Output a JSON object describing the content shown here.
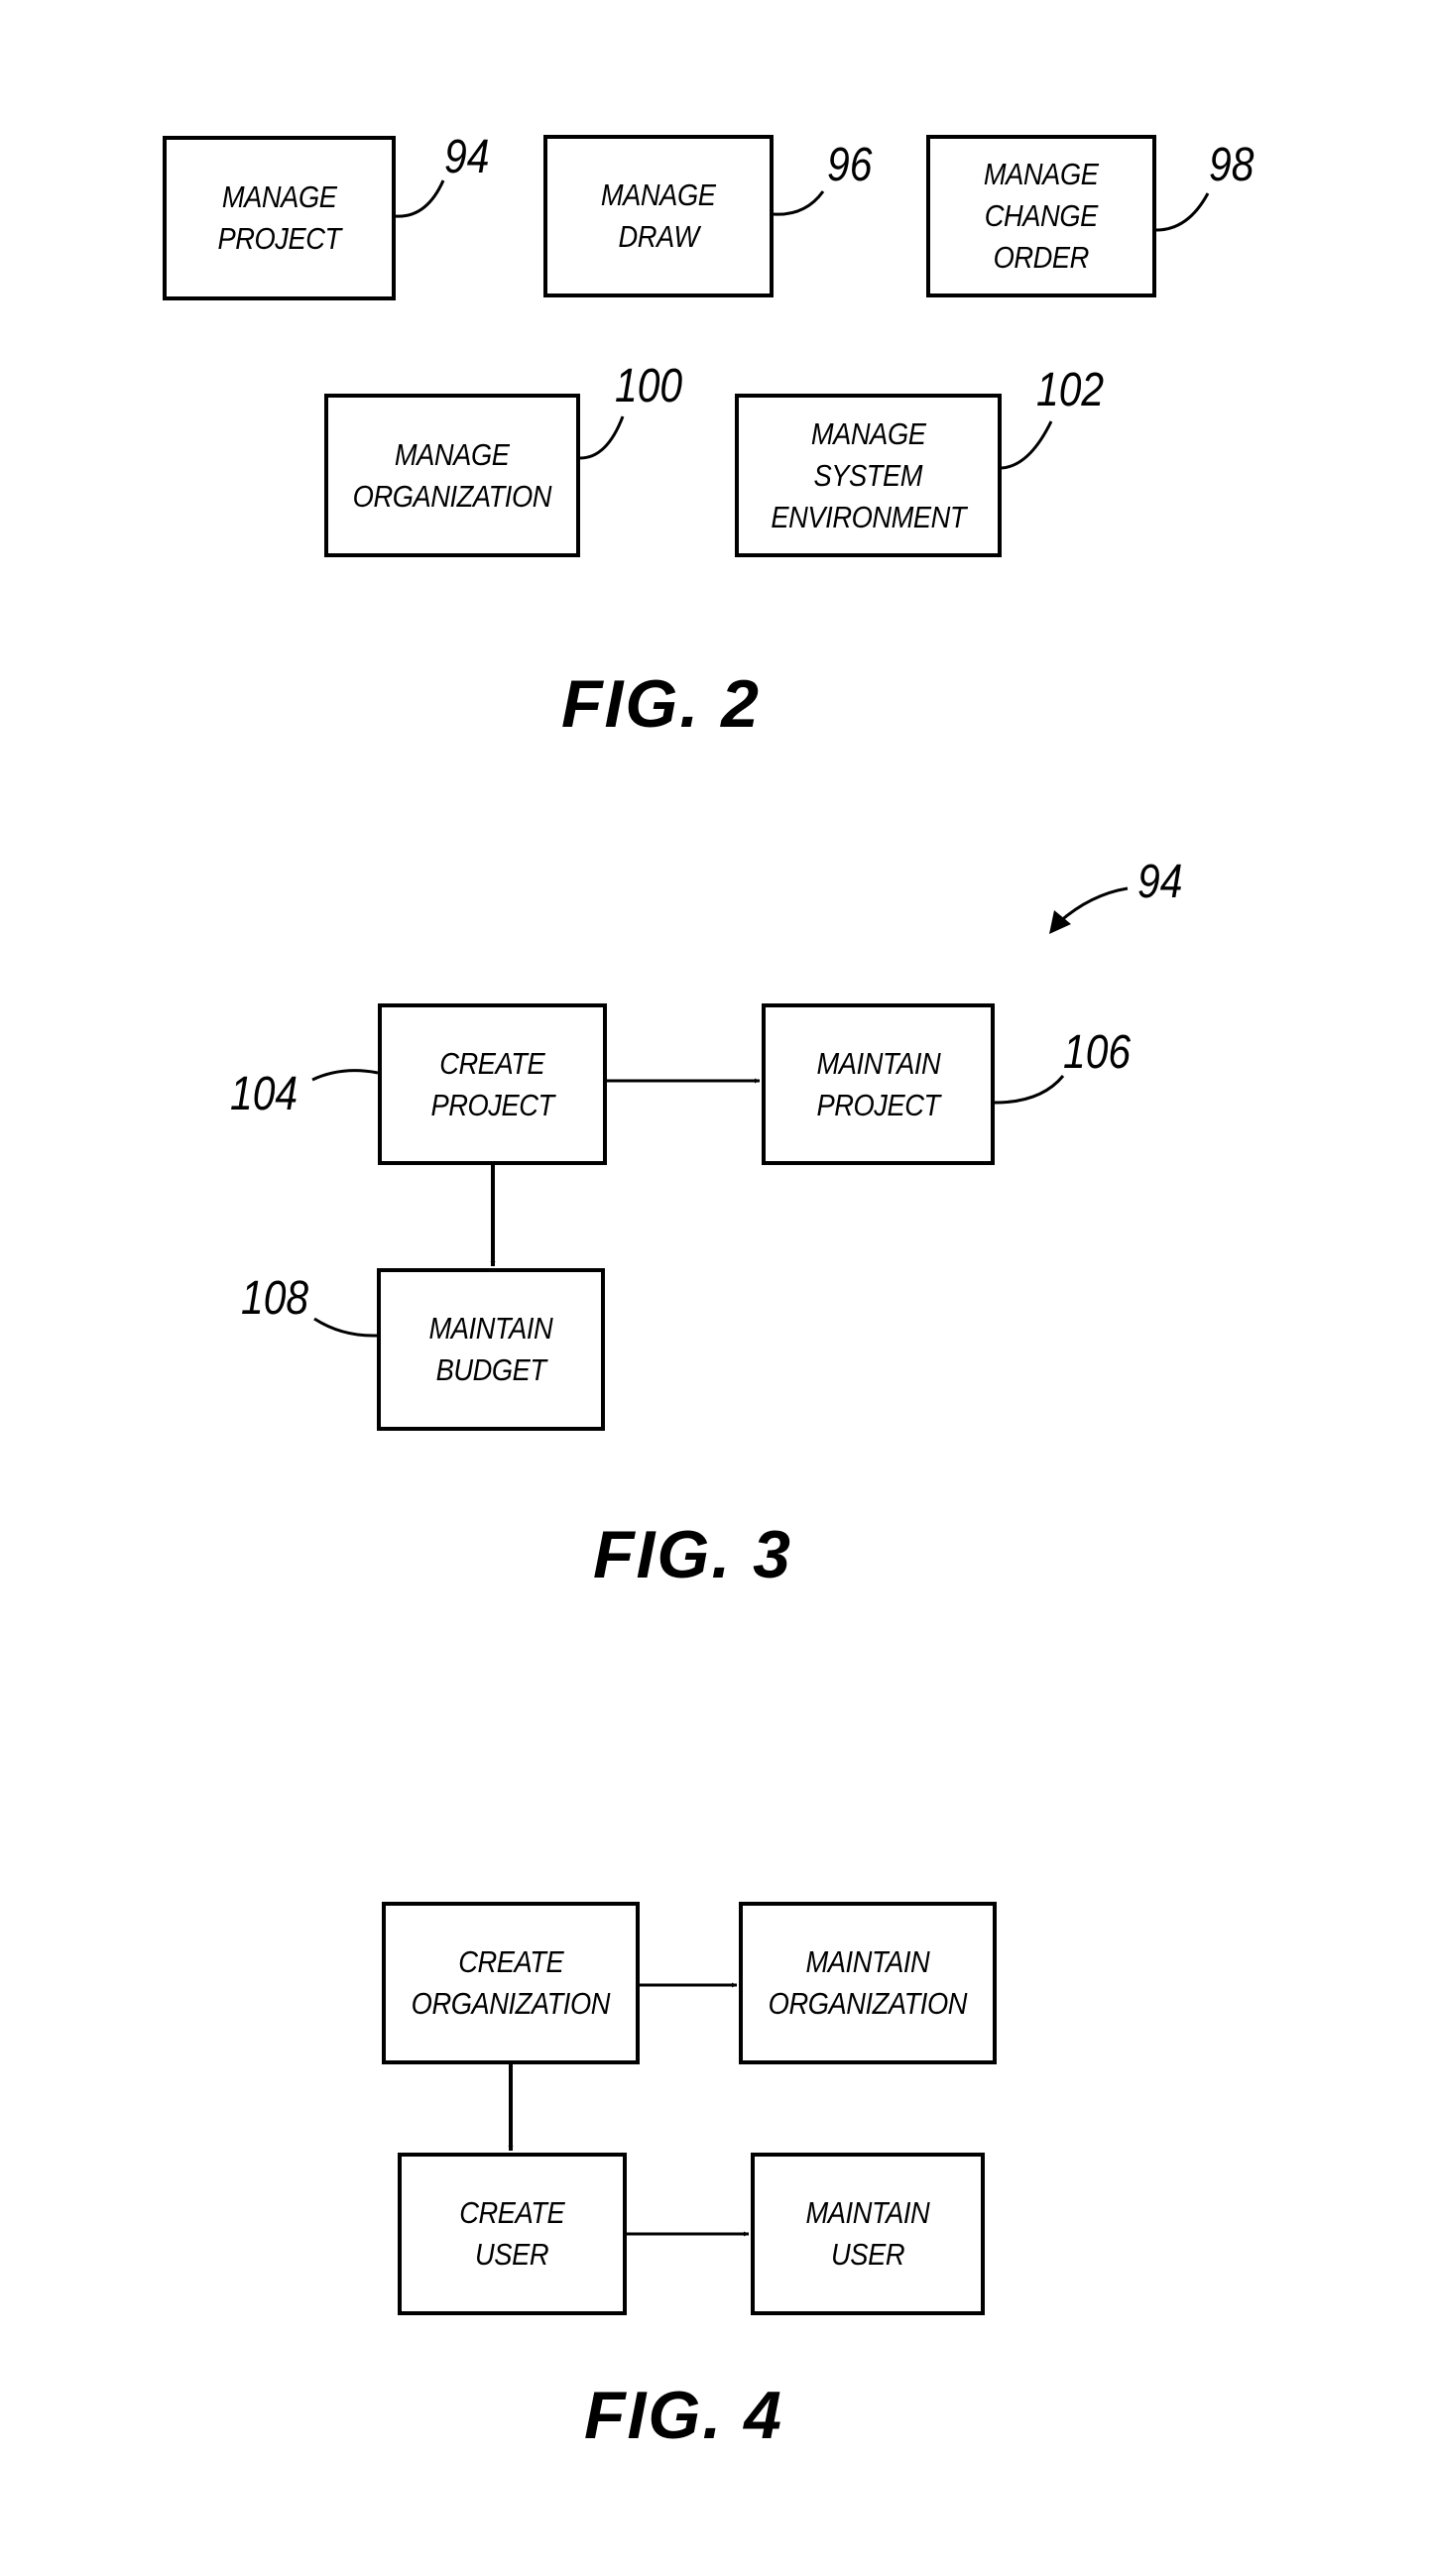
{
  "fig2": {
    "caption": "FIG. 2",
    "blocks": [
      {
        "ref": "94",
        "lines": [
          "MANAGE",
          "PROJECT"
        ]
      },
      {
        "ref": "96",
        "lines": [
          "MANAGE",
          "DRAW"
        ]
      },
      {
        "ref": "98",
        "lines": [
          "MANAGE",
          "CHANGE",
          "ORDER"
        ]
      },
      {
        "ref": "100",
        "lines": [
          "MANAGE",
          "ORGANIZATION"
        ]
      },
      {
        "ref": "102",
        "lines": [
          "MANAGE",
          "SYSTEM",
          "ENVIRONMENT"
        ]
      }
    ]
  },
  "fig3": {
    "caption": "FIG. 3",
    "overall_ref": "94",
    "blocks": [
      {
        "ref": "104",
        "lines": [
          "CREATE",
          "PROJECT"
        ]
      },
      {
        "ref": "106",
        "lines": [
          "MAINTAIN",
          "PROJECT"
        ]
      },
      {
        "ref": "108",
        "lines": [
          "MAINTAIN",
          "BUDGET"
        ]
      }
    ],
    "edges": [
      {
        "from": "CREATE PROJECT",
        "to": "MAINTAIN PROJECT"
      },
      {
        "from": "CREATE PROJECT",
        "to": "MAINTAIN BUDGET"
      }
    ]
  },
  "fig4": {
    "caption": "FIG. 4",
    "blocks": [
      {
        "lines": [
          "CREATE",
          "ORGANIZATION"
        ]
      },
      {
        "lines": [
          "MAINTAIN",
          "ORGANIZATION"
        ]
      },
      {
        "lines": [
          "CREATE",
          "USER"
        ]
      },
      {
        "lines": [
          "MAINTAIN",
          "USER"
        ]
      }
    ],
    "edges": [
      {
        "from": "CREATE ORGANIZATION",
        "to": "MAINTAIN ORGANIZATION"
      },
      {
        "from": "CREATE ORGANIZATION",
        "to": "CREATE USER"
      },
      {
        "from": "CREATE USER",
        "to": "MAINTAIN USER"
      }
    ]
  }
}
